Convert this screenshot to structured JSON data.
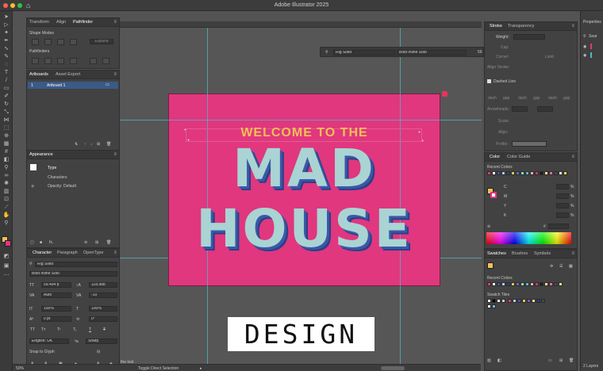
{
  "window": {
    "title": "Adobe Illustrator 2025"
  },
  "left_panel": {
    "tabs": [
      "Transform",
      "Align",
      "Pathfinder"
    ],
    "shape_modes_label": "Shape Modes",
    "expand_label": "Expand",
    "pathfinders_label": "Pathfinders",
    "artboards_tabs": [
      "Artboards",
      "Asset Export"
    ],
    "artboard_row": {
      "index": "1",
      "name": "Artboard 1"
    },
    "appearance": {
      "title": "Appearance",
      "type_label": "Type",
      "characters_label": "Characters",
      "opacity_label": "Opacity:",
      "opacity_value": "Default"
    },
    "character": {
      "tabs": [
        "Character",
        "Paragraph",
        "OpenType"
      ],
      "font_family": "Rig Solid",
      "font_style": "Bold Inline Solo",
      "font_size": "59.494 p",
      "leading": "118.988",
      "kerning": "Auto",
      "tracking": "-10",
      "vscale": "100%",
      "hscale": "100%",
      "baseline": "0 pt",
      "rotation": "0°",
      "language": "English: UK",
      "aa": "Sharp",
      "snap_label": "Snap to Glyph"
    }
  },
  "control_bar": {
    "font_family": "Rig Solid",
    "font_style": "Bold Inline Solo",
    "size": "59"
  },
  "artwork": {
    "line1": "WELCOME TO THE",
    "line2": "MAD",
    "line3": "HOUSE",
    "caption": "DESIGN"
  },
  "status": {
    "zoom": "50%",
    "tool_hint": "Toggle Direct Selection",
    "left_hint": "the tool."
  },
  "stroke_panel": {
    "tabs": [
      "Stroke",
      "Transparency"
    ],
    "weight_label": "Weight:",
    "cap_label": "Cap:",
    "corner_label": "Corner:",
    "limit_label": "Limit:",
    "align_label": "Align Stroke:",
    "dashed_label": "Dashed Line",
    "dash_gap": [
      "dash",
      "gap",
      "dash",
      "gap",
      "dash",
      "gap"
    ],
    "arrowheads_label": "Arrowheads:",
    "scale_label": "Scale:",
    "align2_label": "Align:",
    "profile_label": "Profile:"
  },
  "color_panel": {
    "tabs": [
      "Color",
      "Color Guide"
    ],
    "recent_label": "Recent Colors",
    "channels": [
      "C",
      "M",
      "Y",
      "K"
    ],
    "percent": "%",
    "hex_prefix": "#"
  },
  "swatches_panel": {
    "tabs": [
      "Swatches",
      "Brushes",
      "Symbols"
    ],
    "recent_label": "Recent Colors",
    "tiles_label": "Swatch Tiles"
  },
  "far_right": {
    "title": "Properties",
    "search": "Sear",
    "layers": "2 Layers"
  },
  "colors": {
    "artboard_pink": "#e0377f",
    "headline_yellow": "#f2c055",
    "letter_mint": "#a9d4d3",
    "letter_shadow_blue": "#3a58a8"
  },
  "recent_colors": [
    "#e0377f",
    "#ffffff",
    "#3a58a8",
    "#a9d4d3",
    "#2c3f86",
    "#f2c055",
    "#5b6fb7",
    "#8dd3d6",
    "#60b6c8",
    "#f4a6c4",
    "#c73a77",
    "#1e1e1e",
    "#ffe68a",
    "#ff66aa",
    "#4a4a4a",
    "#ffffff",
    "#ffd84a",
    "#f6e6a6"
  ]
}
